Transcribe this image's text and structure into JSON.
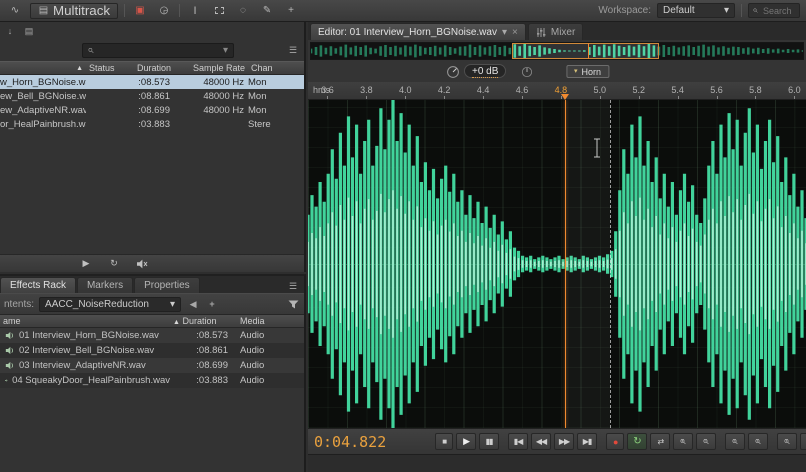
{
  "topbar": {
    "multitrack_label": "Multitrack",
    "workspace_label": "Workspace:",
    "workspace_value": "Default",
    "search_placeholder": "Search"
  },
  "files_panel": {
    "sort_indicator": "▲",
    "columns": {
      "status": "Status",
      "duration": "Duration",
      "sample_rate": "Sample Rate",
      "channels": "Chan"
    },
    "rows": [
      {
        "name": "w_Horn_BGNoise.wav",
        "duration": ":08.573",
        "sample_rate": "48000 Hz",
        "channels": "Mon"
      },
      {
        "name": "ew_Bell_BGNoise.wav",
        "duration": ":08.861",
        "sample_rate": "48000 Hz",
        "channels": "Mon"
      },
      {
        "name": "ew_AdaptiveNR.wav",
        "duration": ":08.699",
        "sample_rate": "48000 Hz",
        "channels": "Mon"
      },
      {
        "name": "or_HealPainbrush.wav",
        "duration": ":03.883",
        "sample_rate": "",
        "channels": "Stere"
      }
    ]
  },
  "effects_panel": {
    "tabs": [
      "Effects Rack",
      "Markers",
      "Properties"
    ],
    "contents_label": "ntents:",
    "preset_value": "AACC_NoiseReduction",
    "sort_indicator": "▲",
    "columns": {
      "name": "ame",
      "duration": "Duration",
      "media": "Media"
    },
    "rows": [
      {
        "name": "01 Interview_Horn_BGNoise.wav",
        "duration": ":08.573",
        "media": "Audio"
      },
      {
        "name": "02 Interview_Bell_BGNoise.wav",
        "duration": ":08.861",
        "media": "Audio"
      },
      {
        "name": "03 Interview_AdaptiveNR.wav",
        "duration": ":08.699",
        "media": "Audio"
      },
      {
        "name": "04 SqueakyDoor_HealPainbrush.wav",
        "duration": ":03.883",
        "media": "Audio"
      }
    ]
  },
  "editor": {
    "tab_label": "Editor: 01 Interview_Horn_BGNoise.wav",
    "mixer_label": "Mixer",
    "db_badge": "+0 dB",
    "marker_label": "Horn",
    "ruler_unit": "hms",
    "ruler_ticks": [
      "3.6",
      "3.8",
      "4.0",
      "4.2",
      "4.4",
      "4.6",
      "4.8",
      "5.0",
      "5.2",
      "5.4",
      "5.6",
      "5.8",
      "6.0"
    ],
    "tick_start": 3.6,
    "tick_step": 0.2,
    "time_start": 3.5,
    "time_end": 6.06,
    "playhead_t": 4.822,
    "secondary_cursor_t": 5.05,
    "marker_t": 5.03,
    "highlight_tick": "4.8",
    "time_display": "0:04.822",
    "file_duration": 8.573,
    "colors": {
      "waveform_green": "#41d39b",
      "playhead_orange": "#f08a30",
      "time_orange": "#e9a13e"
    }
  },
  "transport": {
    "buttons": [
      {
        "name": "stop",
        "glyph": "■"
      },
      {
        "name": "play",
        "glyph": "▶"
      },
      {
        "name": "pause",
        "glyph": "▮▮"
      },
      {
        "name": "skip-to-start",
        "glyph": "▮◀"
      },
      {
        "name": "rewind",
        "glyph": "◀◀"
      },
      {
        "name": "fast-forward",
        "glyph": "▶▶"
      },
      {
        "name": "skip-to-end",
        "glyph": "▶▮"
      },
      {
        "name": "record",
        "glyph": "●"
      },
      {
        "name": "loop",
        "glyph": "↻"
      },
      {
        "name": "shuttle",
        "glyph": "⇄"
      }
    ],
    "zoom_buttons": [
      "zoom-in",
      "zoom-out",
      "zoom-in-horizontal",
      "zoom-out-horizontal",
      "zoom-to-selection",
      "zoom-full"
    ]
  },
  "waveform": {
    "main": [
      0.3,
      0.42,
      0.35,
      0.5,
      0.38,
      0.55,
      0.7,
      0.52,
      0.8,
      0.6,
      0.9,
      0.65,
      0.85,
      0.55,
      0.75,
      0.88,
      0.6,
      0.72,
      0.95,
      0.7,
      0.88,
      1.0,
      0.75,
      0.92,
      0.68,
      0.85,
      0.6,
      0.78,
      0.5,
      0.62,
      0.45,
      0.58,
      0.4,
      0.52,
      0.6,
      0.44,
      0.55,
      0.38,
      0.45,
      0.3,
      0.42,
      0.28,
      0.38,
      0.25,
      0.35,
      0.22,
      0.3,
      0.18,
      0.26,
      0.15,
      0.2,
      0.1,
      0.08,
      0.05,
      0.04,
      0.05,
      0.03,
      0.04,
      0.05,
      0.04,
      0.03,
      0.04,
      0.05,
      0.03,
      0.04,
      0.05,
      0.04,
      0.03,
      0.05,
      0.04,
      0.03,
      0.04,
      0.05,
      0.04,
      0.06,
      0.08,
      0.2,
      0.45,
      0.7,
      0.55,
      0.85,
      0.65,
      0.9,
      0.6,
      0.75,
      0.5,
      0.65,
      0.4,
      0.55,
      0.35,
      0.5,
      0.3,
      0.45,
      0.55,
      0.38,
      0.48,
      0.3,
      0.25,
      0.4,
      0.6,
      0.75,
      0.55,
      0.85,
      0.65,
      0.92,
      0.7,
      0.88,
      0.6,
      0.8,
      0.95,
      0.68,
      0.85,
      0.58,
      0.75,
      0.88,
      0.62,
      0.78,
      0.5,
      0.65,
      0.42,
      0.55,
      0.35,
      0.45,
      0.28
    ],
    "overview": [
      0.3,
      0.5,
      0.7,
      0.4,
      0.6,
      0.35,
      0.55,
      0.8,
      0.45,
      0.65,
      0.5,
      0.7,
      0.4,
      0.3,
      0.6,
      0.75,
      0.5,
      0.65,
      0.45,
      0.7,
      0.55,
      0.8,
      0.6,
      0.4,
      0.5,
      0.65,
      0.45,
      0.7,
      0.5,
      0.35,
      0.55,
      0.6,
      0.8,
      0.5,
      0.7,
      0.45,
      0.6,
      0.75,
      0.5,
      0.65,
      0.4,
      0.85,
      0.6,
      0.9,
      0.65,
      0.5,
      0.7,
      0.45,
      0.35,
      0.25,
      0.15,
      0.08,
      0.05,
      0.05,
      0.06,
      0.1,
      0.5,
      0.75,
      0.55,
      0.8,
      0.6,
      0.85,
      0.65,
      0.5,
      0.7,
      0.55,
      0.8,
      0.6,
      0.9,
      0.7,
      0.55,
      0.75,
      0.5,
      0.65,
      0.45,
      0.6,
      0.7,
      0.5,
      0.65,
      0.8,
      0.55,
      0.7,
      0.45,
      0.6,
      0.4,
      0.55,
      0.5,
      0.35,
      0.45,
      0.3,
      0.4,
      0.25,
      0.35,
      0.2,
      0.3,
      0.15,
      0.25,
      0.15,
      0.2,
      0.1
    ]
  }
}
